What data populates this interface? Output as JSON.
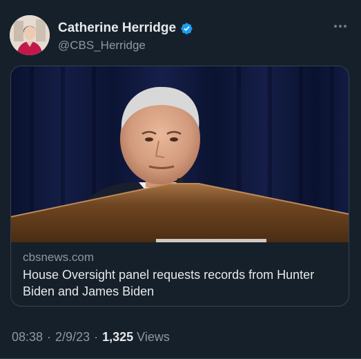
{
  "tweet": {
    "author": {
      "display_name": "Catherine Herridge",
      "handle": "@CBS_Herridge",
      "verified": true,
      "avatar_icon": "profile-photo"
    },
    "more_icon": "more-options-icon",
    "card": {
      "domain": "cbsnews.com",
      "title": "House Oversight panel requests records from Hunter Biden and James Biden",
      "image_icon": "news-photo"
    },
    "meta": {
      "time": "08:38",
      "date": "2/9/23",
      "views_count": "1,325",
      "views_label": "Views"
    }
  },
  "colors": {
    "background": "#15202b",
    "primary_text": "#e7e9ea",
    "secondary_text": "#8b98a5",
    "verified_blue": "#1d9bf0",
    "border": "#38444d"
  }
}
